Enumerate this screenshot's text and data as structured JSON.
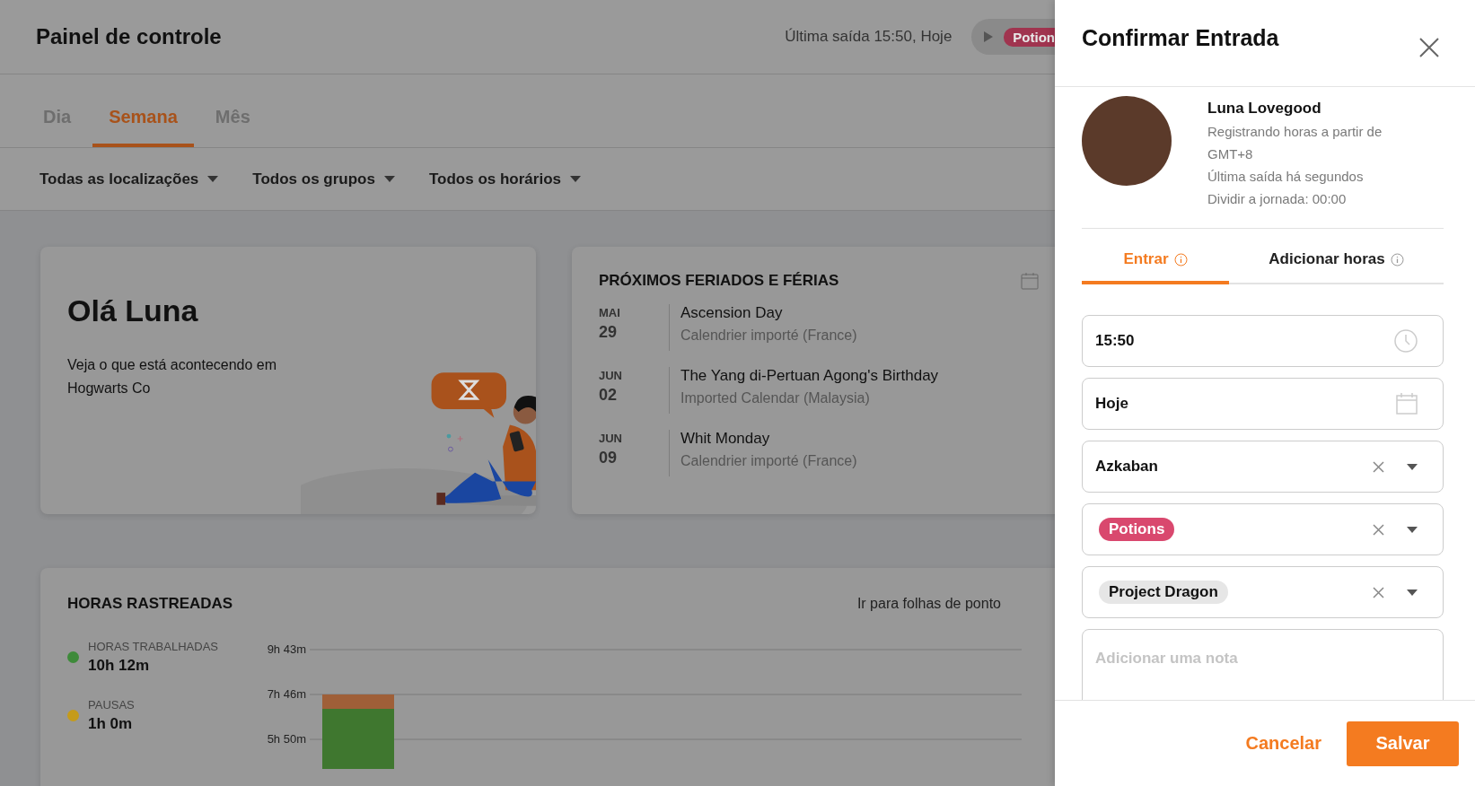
{
  "header": {
    "title": "Painel de controle",
    "last_exit": "Última saída 15:50, Hoje",
    "running_tag": "Potion"
  },
  "tabs": [
    {
      "label": "Dia",
      "selected": false
    },
    {
      "label": "Semana",
      "selected": true
    },
    {
      "label": "Mês",
      "selected": false
    }
  ],
  "filters": [
    "Todas as localizações",
    "Todos os grupos",
    "Todos os horários"
  ],
  "greeting": {
    "title": "Olá Luna",
    "text": "Veja o que está acontecendo em Hogwarts Co"
  },
  "holidays": {
    "title": "PRÓXIMOS FERIADOS E FÉRIAS",
    "items": [
      {
        "month": "MAI",
        "day": "29",
        "name": "Ascension Day",
        "calendar": "Calendrier importé (France)"
      },
      {
        "month": "JUN",
        "day": "02",
        "name": "The Yang di-Pertuan Agong's Birthday",
        "calendar": "Imported Calendar (Malaysia)"
      },
      {
        "month": "JUN",
        "day": "09",
        "name": "Whit Monday",
        "calendar": "Calendrier importé (France)"
      }
    ]
  },
  "tracked": {
    "title": "HORAS RASTREADAS",
    "link": "Ir para folhas de ponto",
    "legend": [
      {
        "label": "HORAS TRABALHADAS",
        "value": "10h 12m",
        "color": "#3e8a3a"
      },
      {
        "label": "PAUSAS",
        "value": "1h 0m",
        "color": "#c59b1a"
      }
    ],
    "axis_labels": [
      "9h 43m",
      "7h 46m",
      "5h 50m"
    ]
  },
  "panel": {
    "title": "Confirmar Entrada",
    "user": {
      "name": "Luna Lovegood",
      "lines": [
        "Registrando horas a partir de GMT+8",
        "Última saída há segundos",
        "Dividir a jornada: 00:00"
      ]
    },
    "tabs": [
      {
        "label": "Entrar",
        "selected": true
      },
      {
        "label": "Adicionar horas",
        "selected": false
      }
    ],
    "fields": [
      {
        "kind": "time",
        "value": "15:50"
      },
      {
        "kind": "date",
        "value": "Hoje"
      },
      {
        "kind": "select",
        "value": "Azkaban"
      },
      {
        "kind": "tag-select",
        "value": "Potions",
        "color": "#d9486e"
      },
      {
        "kind": "tag-select",
        "value": "Project Dragon",
        "color": "#e6e6e6"
      },
      {
        "kind": "note",
        "placeholder": "Adicionar uma nota"
      }
    ],
    "cancel": "Cancelar",
    "save": "Salvar"
  }
}
